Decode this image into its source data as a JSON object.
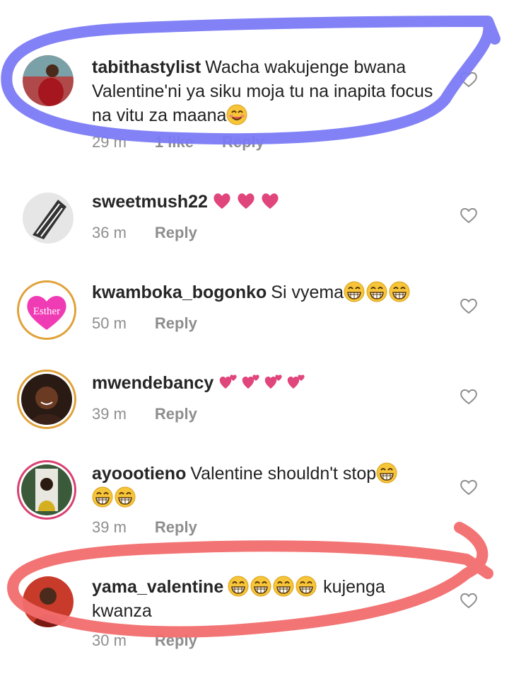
{
  "comments": [
    {
      "username": "tabithastylist",
      "text": "Wacha wakujenge bwana Valentine'ni ya siku moja tu na inapita focus na vitu za maana",
      "time": "29 m",
      "likes": "1 like",
      "reply": "Reply"
    },
    {
      "username": "sweetmush22",
      "text": "",
      "time": "36 m",
      "reply": "Reply"
    },
    {
      "username": "kwamboka_bogonko",
      "text": "Si vyema",
      "time": "50 m",
      "reply": "Reply",
      "avatar_text": "Esther"
    },
    {
      "username": "mwendebancy",
      "text": "",
      "time": "39 m",
      "reply": "Reply"
    },
    {
      "username": "ayoootieno",
      "text": "Valentine shouldn't stop",
      "time": "39 m",
      "reply": "Reply"
    },
    {
      "username": "yama_valentine",
      "text": "kujenga kwanza",
      "time": "30 m",
      "reply": "Reply"
    }
  ],
  "colors": {
    "annotation_blue": "#7b7bf5",
    "annotation_red": "#f26d6d",
    "heart_pink": "#e0457b",
    "story_ring": "#e0a23a"
  },
  "icons": [
    "like-heart-outline-icon",
    "grinning-emoji-icon",
    "pink-heart-emoji",
    "two-hearts-emoji"
  ]
}
